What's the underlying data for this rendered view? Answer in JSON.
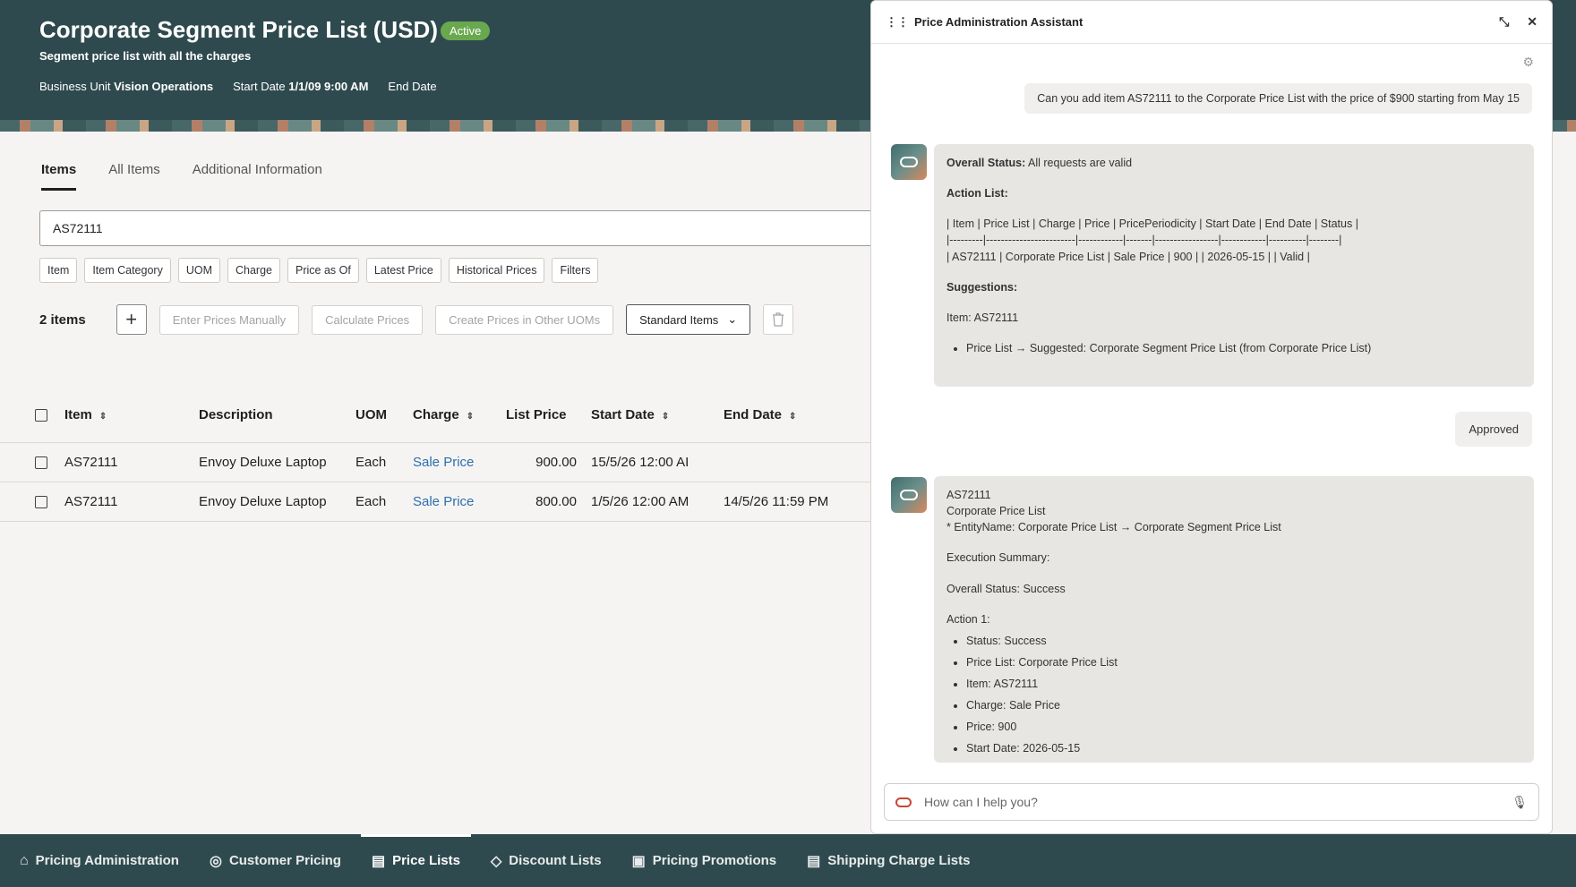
{
  "header": {
    "title": "Corporate Segment Price List (USD)",
    "status": "Active",
    "subtitle": "Segment price list with all the charges",
    "business_unit_label": "Business Unit",
    "business_unit_value": "Vision Operations",
    "start_date_label": "Start Date",
    "start_date_value": "1/1/09 9:00 AM",
    "end_date_label": "End Date"
  },
  "tabs": [
    "Items",
    "All Items",
    "Additional Information"
  ],
  "search": {
    "value": "AS72111"
  },
  "filters": [
    "Item",
    "Item Category",
    "UOM",
    "Charge",
    "Price as Of",
    "Latest Price",
    "Historical Prices",
    "Filters"
  ],
  "toolbar": {
    "count": "2 items",
    "add": "+",
    "enter_prices": "Enter Prices Manually",
    "calculate": "Calculate Prices",
    "create_other_uoms": "Create Prices in Other UOMs",
    "standard_items": "Standard Items"
  },
  "table": {
    "headers": [
      "Item",
      "Description",
      "UOM",
      "Charge",
      "List Price",
      "Start Date",
      "End Date"
    ],
    "rows": [
      [
        "AS72111",
        "Envoy Deluxe Laptop",
        "Each",
        "Sale Price",
        "900.00",
        "15/5/26 12:00 AI",
        ""
      ],
      [
        "AS72111",
        "Envoy Deluxe Laptop",
        "Each",
        "Sale Price",
        "800.00",
        "1/5/26 12:00 AM",
        "14/5/26 11:59 PM"
      ]
    ]
  },
  "bottom_nav": [
    "Pricing Administration",
    "Customer Pricing",
    "Price Lists",
    "Discount Lists",
    "Pricing Promotions",
    "Shipping Charge Lists"
  ],
  "assistant": {
    "title": "Price Administration Assistant",
    "user_message": "Can you add item AS72111 to the Corporate Price List with the price of $900 starting from May 15",
    "reply1": {
      "overall_label": "Overall Status:",
      "overall_value": "All requests are valid",
      "action_list_label": "Action List:",
      "table_line1": "| Item | Price List | Charge | Price | PricePeriodicity | Start Date | End Date | Status |",
      "table_line2": "|---------|------------------------|------------|-------|-----------------|------------|----------|--------|",
      "table_line3": "| AS72111 | Corporate Price List | Sale Price | 900 | | 2026-05-15 | | Valid |",
      "suggestions_label": "Suggestions:",
      "suggestion_item": "Item: AS72111",
      "suggestion_bullet": "Price List → Suggested: Corporate Segment Price List (from Corporate Price List)"
    },
    "approved": "Approved",
    "reply2": {
      "line1": "AS72111",
      "line2": "Corporate Price List",
      "line3": "* EntityName: Corporate Price List → Corporate Segment Price List",
      "exec_summary": "Execution Summary:",
      "overall": "Overall Status: Success",
      "action1": "Action 1:",
      "bullets": [
        "Status: Success",
        "Price List: Corporate Price List",
        "Item: AS72111",
        "Charge: Sale Price",
        "Price: 900",
        "Start Date: 2026-05-15"
      ]
    },
    "input_placeholder": "How can I help you?"
  }
}
